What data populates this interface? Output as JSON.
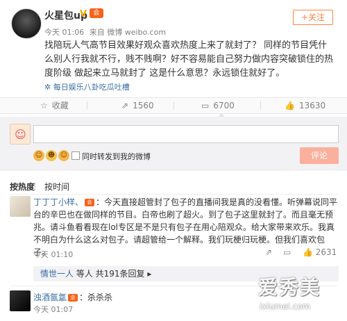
{
  "post": {
    "username": "火星包up",
    "verified": "V",
    "vip_badge": "会",
    "follow_label": "+关注",
    "time": "今天 01:06",
    "source_prefix": "来自",
    "source": "微博 weibo.com",
    "text": "找陪玩人气高节目效果好观众喜欢热度上来了就封了？ 同样的节目凭什么别人行我就不行，贱不贱啊？好不容易能自己努力做内容突破锁住的热度阶级 做起来立马就封了 这是什么意思？永远锁住就好了。",
    "topic": "每日娱乐八卦吃瓜吐槽"
  },
  "actions": {
    "favorite": "收藏",
    "forward": "1560",
    "comment": "6700",
    "like": "13630"
  },
  "comment_box": {
    "placeholder": "",
    "forward_label": "同时转发到我的微博",
    "submit_label": "评论"
  },
  "sort": {
    "hot": "按热度",
    "time": "按时间"
  },
  "comments": [
    {
      "user": "丁丁丁小样、",
      "badge": "会",
      "text": "：今天直接超管封了包子的直播间我是真的没看懂。听弹幕说同平台的辛巴也在做同样的节目。白帝也刷了超火。到了包子这里就封了。而且毫无预兆。请斗鱼看看现在lol专区是不是只有包子在用心陪观众。给大家带来欢乐。我真不明白为什么这么对包子。请超管给一个解释。我们玩梗归玩梗。但我们喜欢包子。",
      "time": "今天 01:10",
      "like_count": "2631",
      "reply_user": "情世一人",
      "reply_text": " 等人 共191条回复"
    },
    {
      "user": "浊酒氤氲",
      "badge": "会",
      "text": "：杀杀杀",
      "time": "今天 01:07"
    }
  ],
  "watermark": {
    "title": "爱秀美",
    "url": "ixiumei.com"
  }
}
